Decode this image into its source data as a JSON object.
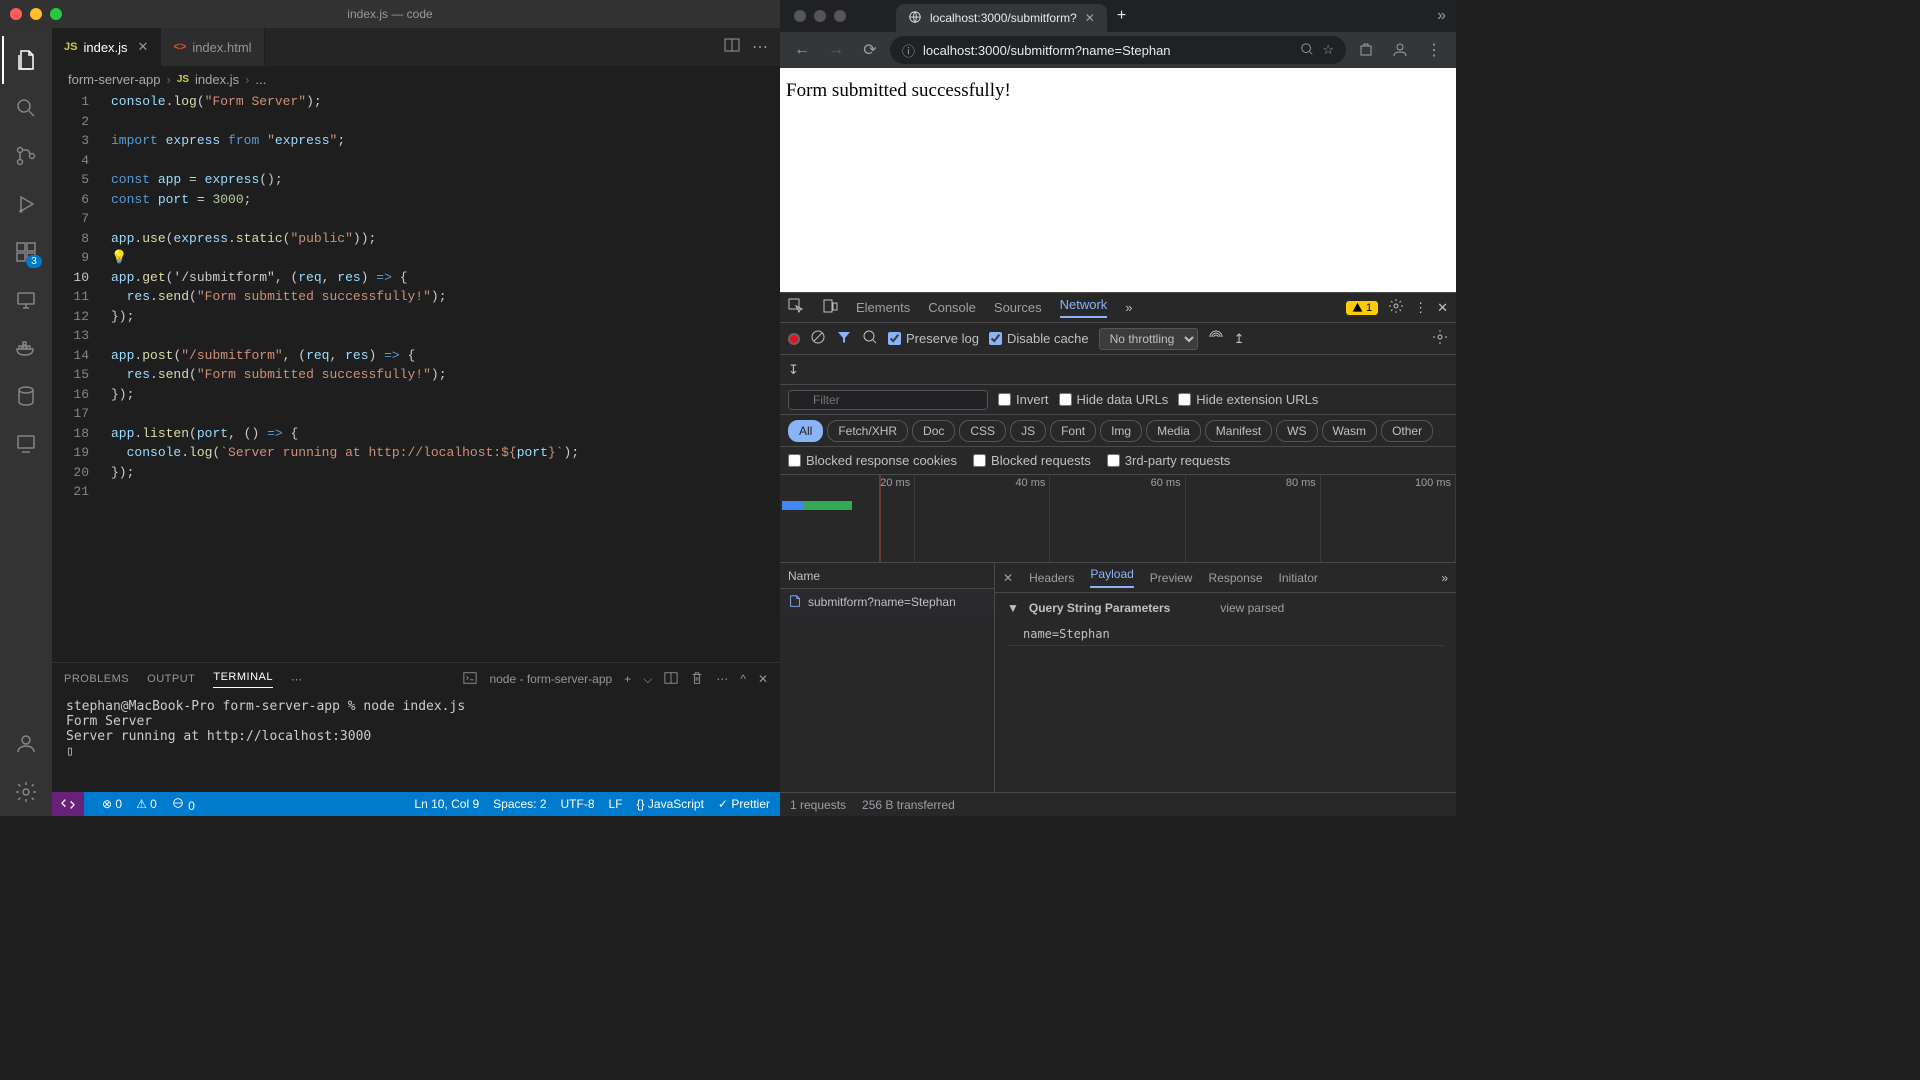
{
  "vscode": {
    "title": "index.js — code",
    "tabs": [
      {
        "icon": "JS",
        "name": "index.js",
        "active": true
      },
      {
        "icon": "HTML",
        "name": "index.html",
        "active": false
      }
    ],
    "breadcrumb": {
      "root": "form-server-app",
      "file": "index.js",
      "symbol": "..."
    },
    "activity_badge": "3",
    "code_lines": [
      "console.log(\"Form Server\");",
      "",
      "import express from \"express\";",
      "",
      "const app = express();",
      "const port = 3000;",
      "",
      "app.use(express.static(\"public\"));",
      "",
      "app.get('/submitform\", (req, res) => {",
      "  res.send(\"Form submitted successfully!\");",
      "});",
      "",
      "app.post(\"/submitform\", (req, res) => {",
      "  res.send(\"Form submitted successfully!\");",
      "});",
      "",
      "app.listen(port, () => {",
      "  console.log(`Server running at http://localhost:${port}`);",
      "});",
      ""
    ],
    "current_line": 10,
    "panel": {
      "tabs": [
        "PROBLEMS",
        "OUTPUT",
        "TERMINAL"
      ],
      "active_tab": "TERMINAL",
      "task_label": "node - form-server-app",
      "terminal_text": "stephan@MacBook-Pro form-server-app % node index.js\nForm Server\nServer running at http://localhost:3000\n▯"
    },
    "status": {
      "errors": "0",
      "warnings": "0",
      "port": "0",
      "cursor": "Ln 10, Col 9",
      "spaces": "Spaces: 2",
      "encoding": "UTF-8",
      "eol": "LF",
      "lang": "JavaScript",
      "prettier": "Prettier"
    }
  },
  "chrome": {
    "tab_title": "localhost:3000/submitform?",
    "url": "localhost:3000/submitform?name=Stephan",
    "page_text": "Form submitted successfully!",
    "devtools": {
      "tabs": [
        "Elements",
        "Console",
        "Sources",
        "Network"
      ],
      "active_tab": "Network",
      "warning_count": "1",
      "preserve_log": "Preserve log",
      "disable_cache": "Disable cache",
      "throttling": "No throttling",
      "filter_placeholder": "Filter",
      "filter_checks": [
        "Invert",
        "Hide data URLs",
        "Hide extension URLs"
      ],
      "type_filters": [
        "All",
        "Fetch/XHR",
        "Doc",
        "CSS",
        "JS",
        "Font",
        "Img",
        "Media",
        "Manifest",
        "WS",
        "Wasm",
        "Other"
      ],
      "active_type": "All",
      "block_checks": [
        "Blocked response cookies",
        "Blocked requests",
        "3rd-party requests"
      ],
      "timeline_labels": [
        "20 ms",
        "40 ms",
        "60 ms",
        "80 ms",
        "100 ms"
      ],
      "name_header": "Name",
      "request_name": "submitform?name=Stephan",
      "detail_tabs": [
        "Headers",
        "Payload",
        "Preview",
        "Response",
        "Initiator"
      ],
      "active_detail": "Payload",
      "payload_section": "Query String Parameters",
      "payload_view": "view parsed",
      "payload_item": "name=Stephan",
      "footer_requests": "1 requests",
      "footer_transferred": "256 B transferred"
    }
  }
}
